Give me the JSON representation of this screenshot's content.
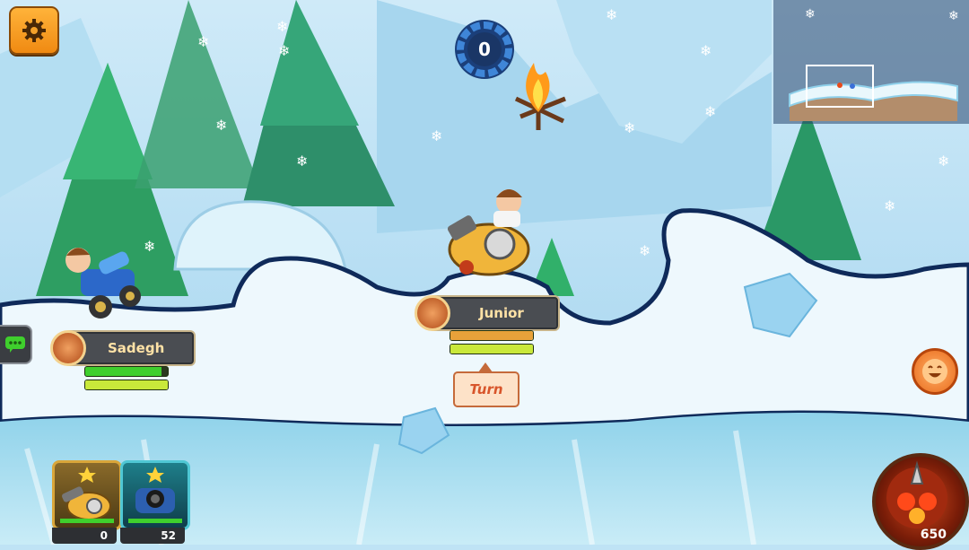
{
  "hud": {
    "wind_value": "0",
    "settings_icon": "gear-icon"
  },
  "players": [
    {
      "name": "Sadegh",
      "health": 0.92,
      "stamina": 1.0
    },
    {
      "name": "Junior",
      "health": 1.0,
      "stamina": 1.0
    }
  ],
  "turn_label": "Turn",
  "items": [
    {
      "icon": "cannon-item-icon",
      "count": "0"
    },
    {
      "icon": "bomber-item-icon",
      "count": "52"
    }
  ],
  "special": {
    "icon": "special-attack-icon",
    "count": "650"
  },
  "colors": {
    "accent_orange": "#f08a12",
    "health_green": "#3fcf2d",
    "stamina_yellow": "#c9e83a",
    "sky": "#bfe3f5",
    "snow": "#eef8fd",
    "outline": "#0f2a5a"
  }
}
